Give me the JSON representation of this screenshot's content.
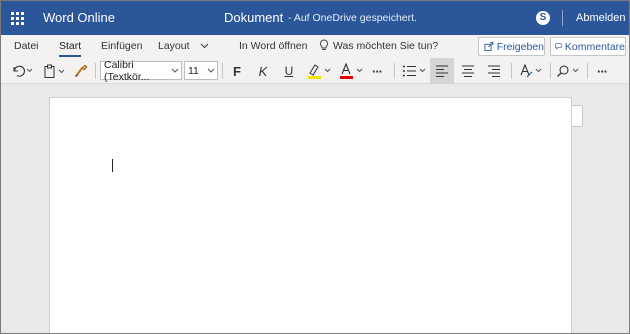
{
  "titlebar": {
    "app_name": "Word Online",
    "doc_title": "Dokument",
    "save_status": "-  Auf OneDrive gespeichert.",
    "sign_out": "Abmelden",
    "colors": {
      "bar": "#2b579a"
    }
  },
  "ribbon": {
    "tabs": [
      {
        "label": "Datei"
      },
      {
        "label": "Start"
      },
      {
        "label": "Einfügen"
      },
      {
        "label": "Layout"
      }
    ],
    "active_tab": "Start",
    "open_in_word": "In Word öffnen",
    "tell_me": "Was möchten Sie tun?",
    "share": "Freigeben",
    "comments": "Kommentare"
  },
  "toolbar": {
    "font_name": "Calibri (Textkör...",
    "font_size": "11",
    "bold": "F",
    "italic": "K",
    "underline": "U",
    "font_color_letter": "A",
    "more": "···",
    "more2": "···",
    "highlight_color": "#f2e600",
    "font_color": "#e00000"
  },
  "icons": {
    "undo": "undo-icon",
    "paste": "clipboard-icon",
    "format_painter": "paintbrush-icon",
    "bullets": "bullet-list-icon",
    "align_left": "align-left-icon",
    "align_center": "align-center-icon",
    "align_right": "align-right-icon",
    "styles": "styles-icon",
    "find": "search-icon",
    "skype": "skype-icon",
    "waffle": "app-launcher-icon",
    "bulb": "lightbulb-icon"
  }
}
